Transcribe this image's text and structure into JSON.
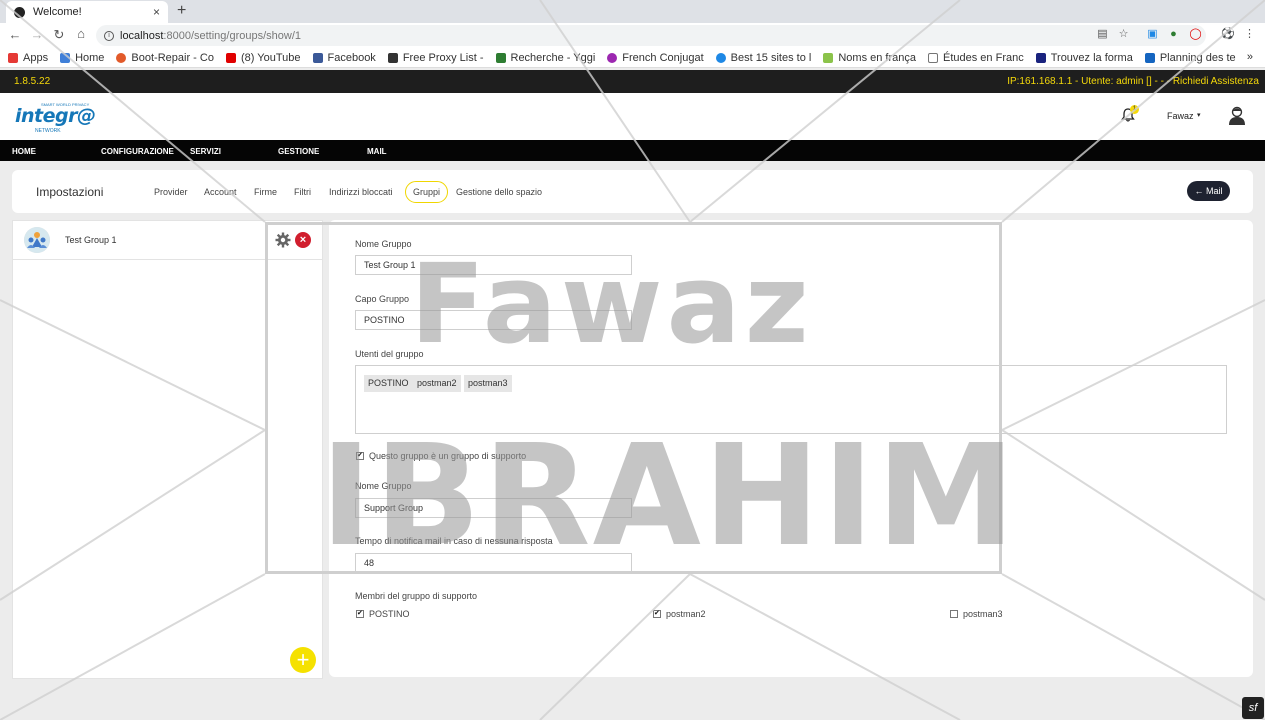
{
  "browser": {
    "tab_title": "Welcome!",
    "tab_close": "×",
    "new_tab": "+",
    "url_host": "localhost",
    "url_rest": ":8000/setting/groups/show/1",
    "bookmarks": [
      {
        "label": "Apps",
        "color": "#e53935"
      },
      {
        "label": "Home",
        "color": "#3f7fd8"
      },
      {
        "label": "Boot-Repair - Co",
        "color": "#e25a2a"
      },
      {
        "label": "(8) YouTube",
        "color": "#e00000"
      },
      {
        "label": "Facebook",
        "color": "#3b5998"
      },
      {
        "label": "Free Proxy List -",
        "color": "#333333"
      },
      {
        "label": "Recherche - Yggi",
        "color": "#2e7d32"
      },
      {
        "label": "French Conjugat",
        "color": "#9c27b0"
      },
      {
        "label": "Best 15 sites to l",
        "color": "#1e88e5"
      },
      {
        "label": "Noms en frança",
        "color": "#8bc34a"
      },
      {
        "label": "Études en Franc",
        "color": "#757575"
      },
      {
        "label": "Trouvez la forma",
        "color": "#1a237e"
      },
      {
        "label": "Planning des te",
        "color": "#1565c0"
      }
    ],
    "bookmarks_more": "»"
  },
  "status": {
    "version": "1.8.5.22",
    "info": "IP:161.168.1.1 - Utente: admin [] - - - Richiedi Assistenza"
  },
  "header": {
    "logo_word": "integr@",
    "logo_top": "SMART WORLD PRIVACY",
    "logo_tag": "NETWORK",
    "notifications": "1",
    "user_name": "Fawaz",
    "user_caret": "▾"
  },
  "menu": [
    "HOME",
    "CONFIGURAZIONE",
    "SERVIZI",
    "GESTIONE",
    "MAIL"
  ],
  "settings": {
    "title": "Impostazioni",
    "tabs": [
      "Provider",
      "Account",
      "Firme",
      "Filtri",
      "Indirizzi bloccati",
      "Gruppi",
      "Gestione dello spazio"
    ],
    "active_tab": "Gruppi",
    "mail_button": "← Mail"
  },
  "groups": {
    "items": [
      {
        "name": "Test Group 1"
      }
    ],
    "add_label": "+"
  },
  "form": {
    "group_name_label": "Nome Gruppo",
    "group_name_value": "Test Group 1",
    "leader_label": "Capo Gruppo",
    "leader_value": "POSTINO",
    "users_label": "Utenti del gruppo",
    "users": [
      "POSTINO",
      "postman2",
      "postman3"
    ],
    "support_checkbox_label": "Questo gruppo è un gruppo di supporto",
    "support_checked": true,
    "support_name_label": "Nome Gruppo",
    "support_name_value": "Support Group",
    "notify_label": "Tempo di notifica mail in caso di nessuna risposta",
    "notify_value": "48",
    "members_label": "Membri del gruppo di supporto",
    "members": [
      {
        "name": "POSTINO",
        "checked": true
      },
      {
        "name": "postman2",
        "checked": true
      },
      {
        "name": "postman3",
        "checked": false
      }
    ]
  },
  "watermark": {
    "line1": "Fawaz",
    "line2": "IBRAHIM"
  },
  "footer_badge": "sf"
}
